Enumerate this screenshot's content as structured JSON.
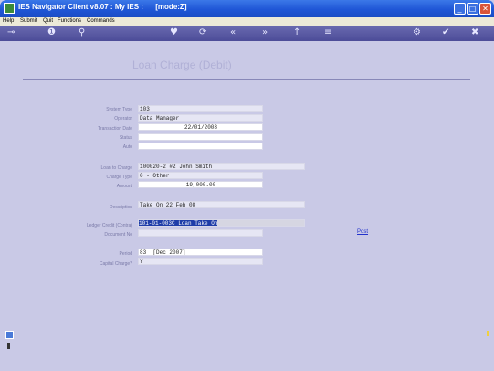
{
  "window": {
    "title": "IES Navigator Client v8.07 : My IES :      [mode:Z]",
    "minimize": "_",
    "maximize": "□",
    "close": "✕"
  },
  "menu": [
    "Help",
    "Submit",
    "Quit",
    "Functions",
    "Commands"
  ],
  "toolbar": {
    "icons": [
      "key",
      "info",
      "search",
      "heart",
      "refresh",
      "rewind",
      "fast-forward",
      "up-arrow",
      "list",
      "gear",
      "check",
      "close"
    ],
    "glyphs": {
      "key": "⊸",
      "info": "❶",
      "search": "⚲",
      "heart": "♥",
      "refresh": "⟳",
      "rewind": "«",
      "fast_forward": "»",
      "up": "↑",
      "list": "≡",
      "gear": "⚙",
      "check": "✔",
      "close": "✖"
    }
  },
  "page": {
    "title": "Loan Charge (Debit)"
  },
  "form": {
    "system_type": {
      "label": "System Type",
      "value": "103"
    },
    "operator": {
      "label": "Operator",
      "value": "Data Manager"
    },
    "transaction_date": {
      "label": "Transaction Date",
      "value": "22/01/2008"
    },
    "status": {
      "label": "Status",
      "value": ""
    },
    "auto": {
      "label": "Auto",
      "value": ""
    },
    "loan_to_charge": {
      "label": "Loan to Charge",
      "value": "100020-2 #2 John Smith"
    },
    "charge_type": {
      "label": "Charge Type",
      "value": "0 - Other"
    },
    "amount": {
      "label": "Amount",
      "value": "19,000.00"
    },
    "description": {
      "label": "Description",
      "value": "Take On 22 Feb 08"
    },
    "ledger_credit": {
      "label": "Ledger Credit (Contra)",
      "value": "101-01-003C Loan Take On"
    },
    "document_no": {
      "label": "Document No",
      "value": ""
    },
    "post_link": "Post",
    "period": {
      "label": "Period",
      "value": "83  [Dec 2007]"
    },
    "capital_charge": {
      "label": "Capital Charge?",
      "value": "Y"
    }
  },
  "colors": {
    "background": "#c9c9e6",
    "selection": "#1f3da8",
    "titlebar": "#1f56d6"
  }
}
